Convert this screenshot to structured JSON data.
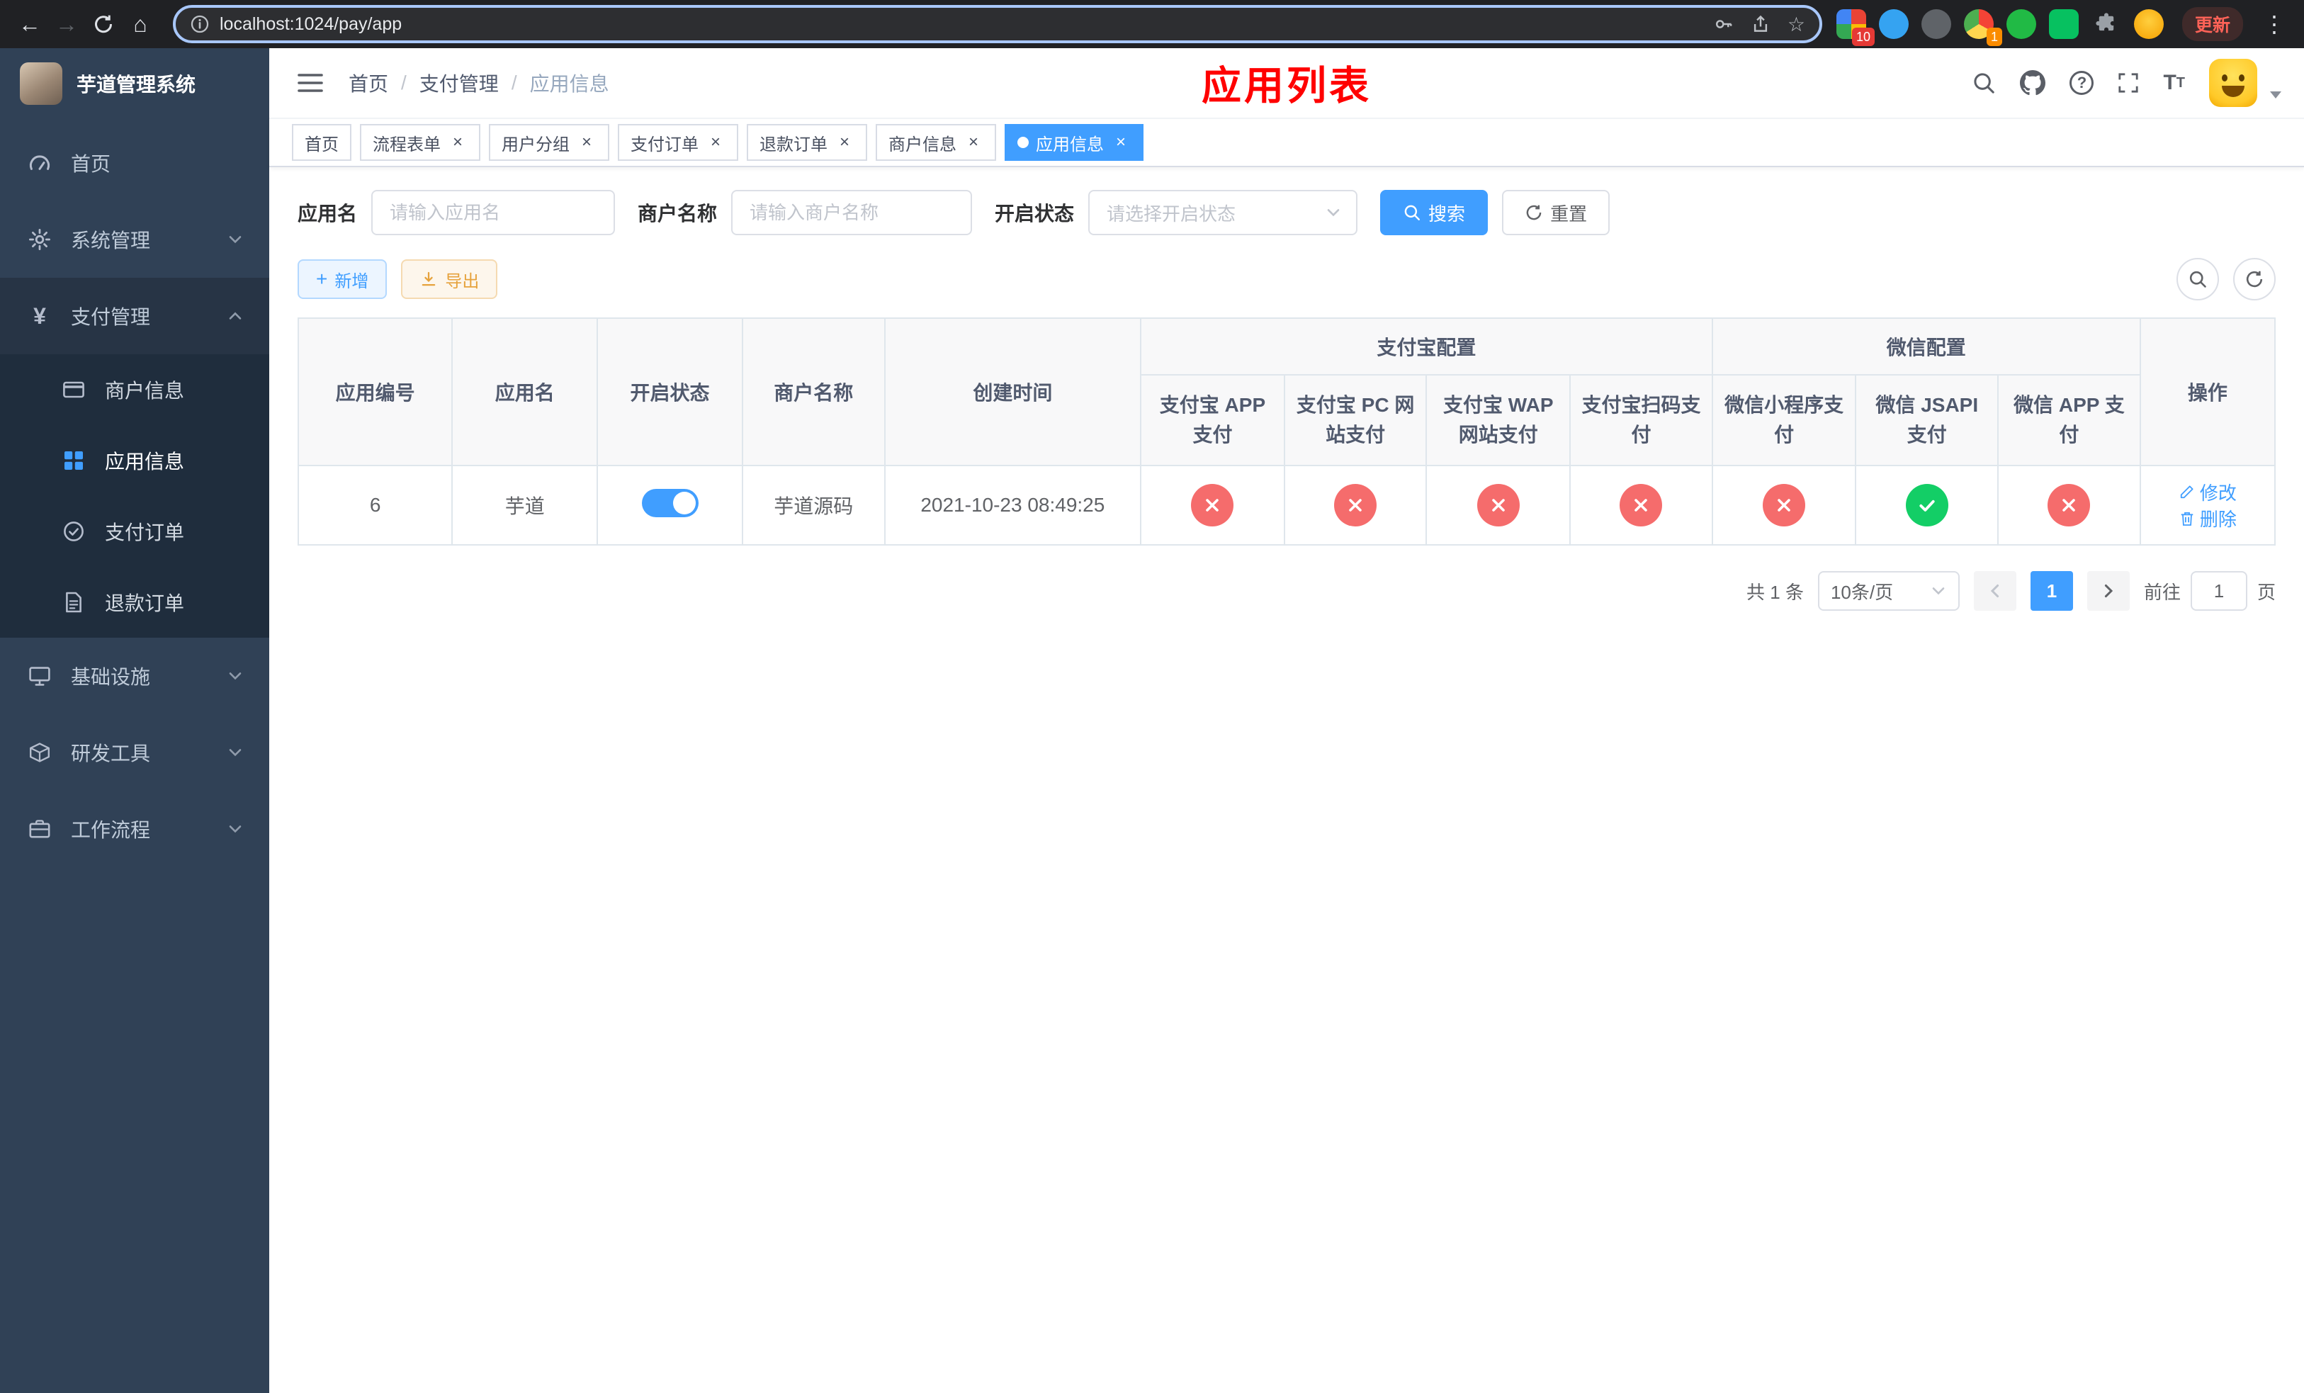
{
  "browser": {
    "url": "localhost:1024/pay/app",
    "update_button": "更新",
    "ext_badge_1": "10",
    "ext_badge_2": "1"
  },
  "sidebar": {
    "app_title": "芋道管理系统",
    "menu": [
      {
        "key": "home",
        "label": "首页",
        "icon": "dashboard-icon",
        "type": "item"
      },
      {
        "key": "system-management",
        "label": "系统管理",
        "icon": "gear-icon",
        "type": "group",
        "state": "collapsed"
      },
      {
        "key": "payment-management",
        "label": "支付管理",
        "icon": "yen-icon",
        "type": "group",
        "state": "expanded",
        "children": [
          {
            "key": "merchant-info",
            "label": "商户信息",
            "icon": "bank-card-icon",
            "active": false
          },
          {
            "key": "app-info",
            "label": "应用信息",
            "icon": "app-grid-icon",
            "active": true
          },
          {
            "key": "pay-order",
            "label": "支付订单",
            "icon": "order-check-icon",
            "active": false
          },
          {
            "key": "refund-order",
            "label": "退款订单",
            "icon": "refund-doc-icon",
            "active": false
          }
        ]
      },
      {
        "key": "infrastructure",
        "label": "基础设施",
        "icon": "monitor-icon",
        "type": "group",
        "state": "collapsed"
      },
      {
        "key": "dev-tools",
        "label": "研发工具",
        "icon": "toolbox-icon",
        "type": "group",
        "state": "collapsed"
      },
      {
        "key": "workflow",
        "label": "工作流程",
        "icon": "workflow-icon",
        "type": "group",
        "state": "collapsed"
      }
    ]
  },
  "navbar": {
    "breadcrumb": [
      "首页",
      "支付管理",
      "应用信息"
    ],
    "page_title": "应用列表"
  },
  "tabs": [
    {
      "key": "home",
      "label": "首页",
      "closable": false,
      "active": false
    },
    {
      "key": "flow-form",
      "label": "流程表单",
      "closable": true,
      "active": false
    },
    {
      "key": "user-group",
      "label": "用户分组",
      "closable": true,
      "active": false
    },
    {
      "key": "pay-order",
      "label": "支付订单",
      "closable": true,
      "active": false
    },
    {
      "key": "refund-order",
      "label": "退款订单",
      "closable": true,
      "active": false
    },
    {
      "key": "merchant-info",
      "label": "商户信息",
      "closable": true,
      "active": false
    },
    {
      "key": "app-info",
      "label": "应用信息",
      "closable": true,
      "active": true
    }
  ],
  "filters": {
    "app_name": {
      "label": "应用名",
      "placeholder": "请输入应用名",
      "value": ""
    },
    "merchant_name": {
      "label": "商户名称",
      "placeholder": "请输入商户名称",
      "value": ""
    },
    "status": {
      "label": "开启状态",
      "placeholder": "请选择开启状态",
      "value": ""
    },
    "search_button": "搜索",
    "reset_button": "重置"
  },
  "toolbar": {
    "add_button": "新增",
    "export_button": "导出"
  },
  "table": {
    "simple_columns": [
      "应用编号",
      "应用名",
      "开启状态",
      "商户名称",
      "创建时间"
    ],
    "alipay_group": {
      "label": "支付宝配置",
      "columns": [
        "支付宝 APP 支付",
        "支付宝 PC 网站支付",
        "支付宝 WAP 网站支付",
        "支付宝扫码支付"
      ]
    },
    "wechat_group": {
      "label": "微信配置",
      "columns": [
        "微信小程序支付",
        "微信 JSAPI 支付",
        "微信 APP 支付"
      ]
    },
    "actions_column": "操作",
    "rows": [
      {
        "app_id": "6",
        "app_name": "芋道",
        "status_on": true,
        "merchant_name": "芋道源码",
        "create_time": "2021-10-23 08:49:25",
        "pay_configs": [
          "fail",
          "fail",
          "fail",
          "fail",
          "fail",
          "success",
          "fail"
        ],
        "edit_label": "修改",
        "delete_label": "删除"
      }
    ]
  },
  "pagination": {
    "total_text": "共 1 条",
    "page_size_text": "10条/页",
    "current_page": "1",
    "goto_label": "前往",
    "goto_value": "1",
    "goto_suffix": "页"
  },
  "colors": {
    "primary": "#409eff",
    "success": "#13ce66",
    "danger": "#f56c6c",
    "warning": "#e6a23c",
    "page_title_red": "#ff0000",
    "sidebar_bg": "#304156",
    "submenu_bg": "#1f2d3d"
  }
}
